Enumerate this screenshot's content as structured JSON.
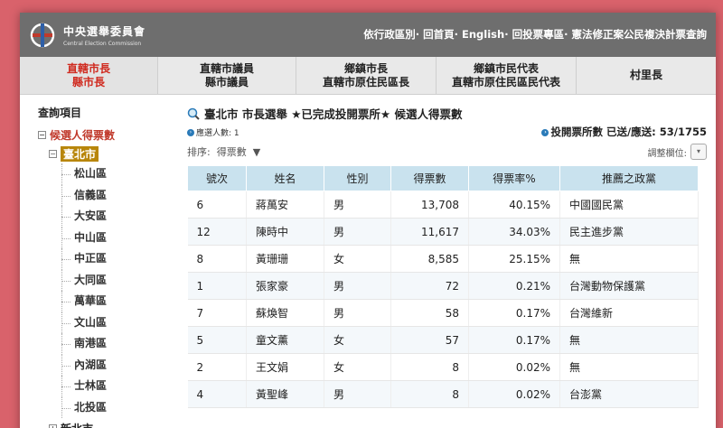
{
  "header": {
    "org_name_cn": "中央選舉委員會",
    "org_name_en": "Central Election Commission",
    "nav": [
      "依行政區別",
      "回首頁",
      "English",
      "回投票專區",
      "憲法修正案公民複決計票查詢"
    ],
    "nav_sep": "·"
  },
  "tabs": [
    {
      "line1": "直轄市長",
      "line2": "縣市長",
      "active": true
    },
    {
      "line1": "直轄市議員",
      "line2": "縣市議員",
      "active": false
    },
    {
      "line1": "鄉鎮市長",
      "line2": "直轄市原住民區長",
      "active": false
    },
    {
      "line1": "鄉鎮市民代表",
      "line2": "直轄市原住民區民代表",
      "active": false
    },
    {
      "line1": "村里長",
      "line2": "",
      "active": false
    }
  ],
  "sidebar": {
    "title": "查詢項目",
    "section": "候選人得票數",
    "selected": "臺北市",
    "districts": [
      "松山區",
      "信義區",
      "大安區",
      "中山區",
      "中正區",
      "大同區",
      "萬華區",
      "文山區",
      "南港區",
      "內湖區",
      "士林區",
      "北投區"
    ],
    "next_city": "新北市"
  },
  "main": {
    "title": "臺北市 市長選舉 ★已完成投開票所★ 候選人得票數",
    "elected_label": "應選人數: 1",
    "stations": "投開票所數 已送/應送: 53/1755",
    "sort_label": "排序:",
    "sort_value": "得票數",
    "sort_arrow": "▼",
    "adjust_label": "調整欄位:"
  },
  "table": {
    "headers": [
      "號次",
      "姓名",
      "性別",
      "得票數",
      "得票率%",
      "推薦之政黨"
    ],
    "rows": [
      [
        "6",
        "蔣萬安",
        "男",
        "13,708",
        "40.15%",
        "中國國民黨"
      ],
      [
        "12",
        "陳時中",
        "男",
        "11,617",
        "34.03%",
        "民主進步黨"
      ],
      [
        "8",
        "黃珊珊",
        "女",
        "8,585",
        "25.15%",
        "無"
      ],
      [
        "1",
        "張家豪",
        "男",
        "72",
        "0.21%",
        "台灣動物保護黨"
      ],
      [
        "7",
        "蘇煥智",
        "男",
        "58",
        "0.17%",
        "台灣維新"
      ],
      [
        "5",
        "童文薰",
        "女",
        "57",
        "0.17%",
        "無"
      ],
      [
        "2",
        "王文娟",
        "女",
        "8",
        "0.02%",
        "無"
      ],
      [
        "4",
        "黃聖峰",
        "男",
        "8",
        "0.02%",
        "台澎黨"
      ]
    ]
  },
  "colors": {
    "background": "#d9626b",
    "header": "#6e6e6e",
    "active_tab": "#d02b20",
    "table_header": "#c9e2ee",
    "selected_node": "#b8860b"
  }
}
